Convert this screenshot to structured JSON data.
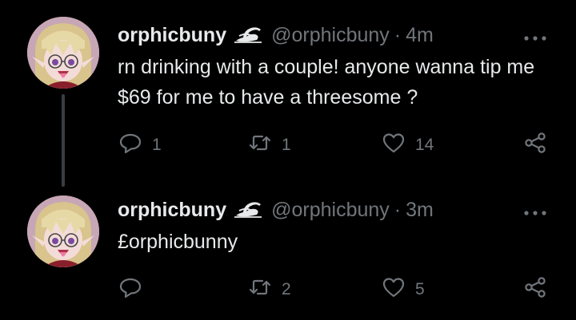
{
  "tweets": [
    {
      "display_name": "orphicbuny",
      "badge_icon": "swan-emoji-icon",
      "handle": "@orphicbuny",
      "separator": "·",
      "time": "4m",
      "text": "rn drinking with a couple! anyone wanna tip me $69 for me to have a threesome ?",
      "reply_count": "1",
      "retweet_count": "1",
      "like_count": "14"
    },
    {
      "display_name": "orphicbuny",
      "badge_icon": "swan-emoji-icon",
      "handle": "@orphicbuny",
      "separator": "·",
      "time": "3m",
      "text": "£orphicbunny",
      "reply_count": "",
      "retweet_count": "2",
      "like_count": "5"
    }
  ],
  "colors": {
    "background": "#000000",
    "primary_text": "#e7e9ea",
    "secondary_text": "#71767b",
    "thread_line": "#3a3d41"
  }
}
